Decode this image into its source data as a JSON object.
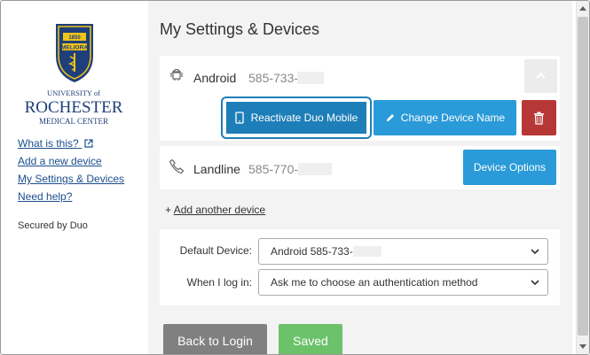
{
  "sidebar": {
    "logo": {
      "year": "1850",
      "motto": "MELIORA",
      "line1": "UNIVERSITY of",
      "line2": "ROCHESTER",
      "line3": "MEDICAL CENTER",
      "colors": {
        "navy": "#1f3f7a",
        "gold": "#f0c419"
      }
    },
    "links": [
      {
        "label": "What is this?",
        "icon": "external-link-icon"
      },
      {
        "label": "Add a new device"
      },
      {
        "label": "My Settings & Devices"
      },
      {
        "label": "Need help?"
      }
    ],
    "secured": "Secured by Duo"
  },
  "main": {
    "title": "My Settings & Devices",
    "devices": [
      {
        "icon": "android-icon",
        "name": "Android",
        "number": "585-733-",
        "buttons": {
          "reactivate": "Reactivate Duo Mobile",
          "change_name": "Change Device Name",
          "delete_icon": "trash-icon"
        }
      },
      {
        "icon": "phone-icon",
        "name": "Landline",
        "number": "585-770-",
        "options": "Device Options"
      }
    ],
    "add_device": {
      "prefix": "+",
      "label": "Add another device"
    },
    "settings": {
      "default_label": "Default Device:",
      "default_value": "Android 585-733-",
      "login_label": "When I log in:",
      "login_value": "Ask me to choose an authentication method"
    },
    "actions": {
      "back": "Back to Login",
      "saved": "Saved"
    }
  },
  "colors": {
    "primary": "#2a9ad8",
    "danger": "#b73737",
    "success": "#6cc26a",
    "gray": "#808080"
  }
}
